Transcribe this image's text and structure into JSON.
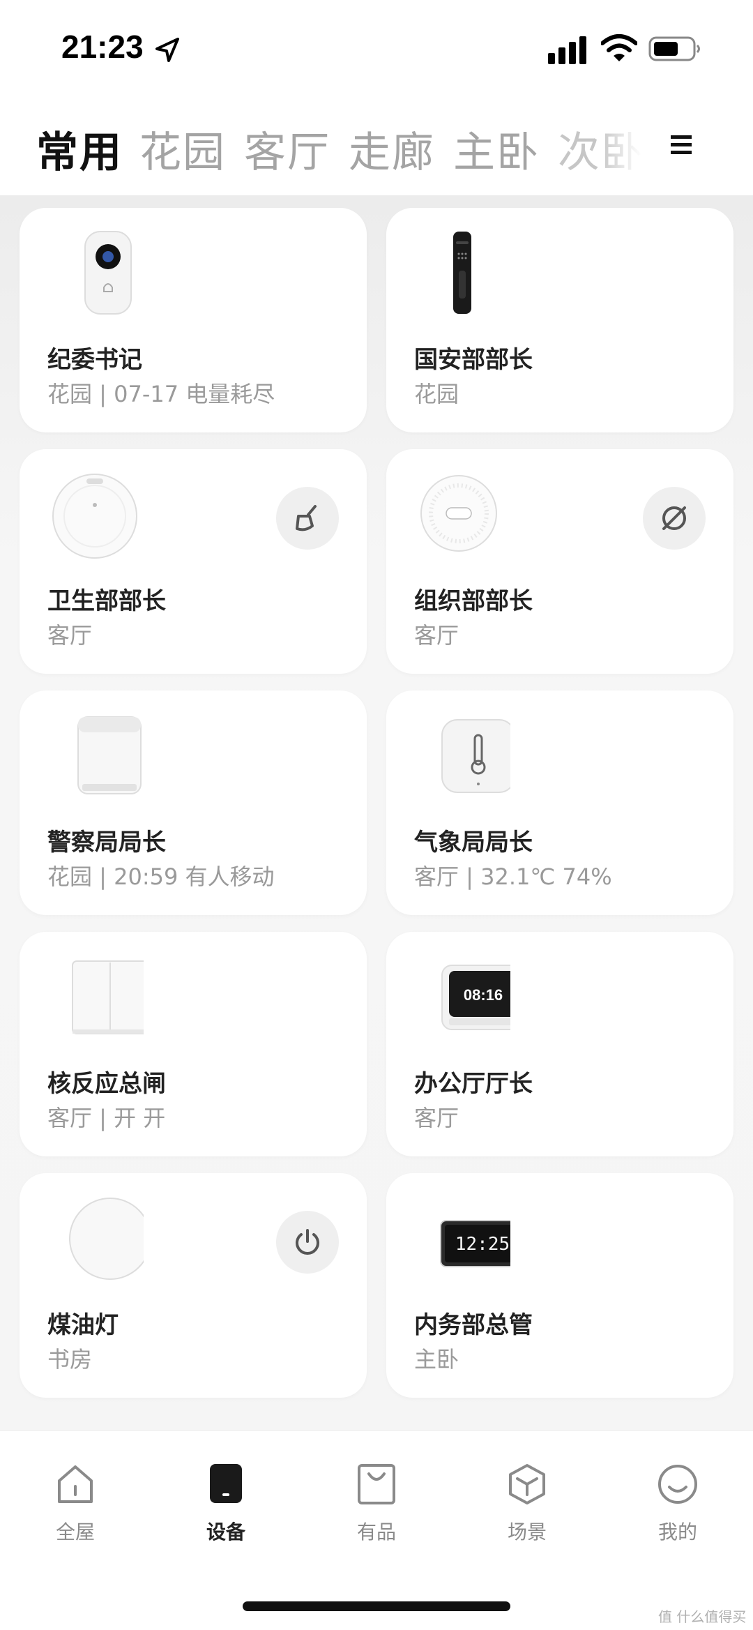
{
  "status_bar": {
    "time": "21:23"
  },
  "tabs": [
    "常用",
    "花园",
    "客厅",
    "走廊",
    "主卧",
    "次卧"
  ],
  "devices": [
    {
      "name": "纪委书记",
      "sub": "花园 | 07-17 电量耗尽",
      "icon": "doorbell-camera-icon"
    },
    {
      "name": "国安部部长",
      "sub": "花园",
      "icon": "smart-lock-icon"
    },
    {
      "name": "卫生部部长",
      "sub": "客厅",
      "icon": "robot-vacuum-icon",
      "action": "broom-icon"
    },
    {
      "name": "组织部部长",
      "sub": "客厅",
      "icon": "gateway-hub-icon",
      "action": "disabled-link-icon"
    },
    {
      "name": "警察局局长",
      "sub": "花园 | 20:59 有人移动",
      "icon": "motion-sensor-icon"
    },
    {
      "name": "气象局局长",
      "sub": "客厅 | 32.1℃ 74%",
      "icon": "thermometer-sensor-icon"
    },
    {
      "name": "核反应总闸",
      "sub": "客厅 | 开 开",
      "icon": "wall-switch-icon"
    },
    {
      "name": "办公厅厅长",
      "sub": "客厅",
      "icon": "smart-display-icon",
      "clock_text": "08:16"
    },
    {
      "name": "煤油灯",
      "sub": "书房",
      "icon": "ceiling-light-icon",
      "action": "power-icon"
    },
    {
      "name": "内务部总管",
      "sub": "主卧",
      "icon": "alarm-clock-icon",
      "clock_text": "12:25"
    }
  ],
  "bottom_nav": [
    {
      "label": "全屋",
      "icon": "house-icon"
    },
    {
      "label": "设备",
      "icon": "device-icon",
      "active": true
    },
    {
      "label": "有品",
      "icon": "shopping-bag-icon"
    },
    {
      "label": "场景",
      "icon": "cube-icon"
    },
    {
      "label": "我的",
      "icon": "smiley-icon"
    }
  ],
  "watermark": "值 什么值得买"
}
